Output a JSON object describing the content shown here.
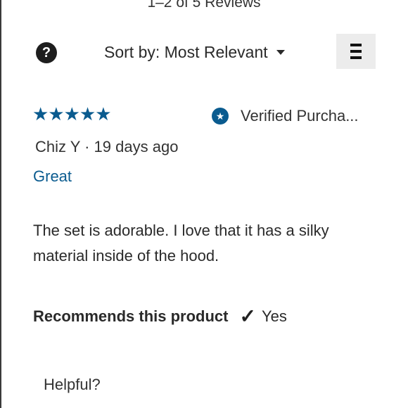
{
  "header": {
    "review_count": "1–2 of 5 Reviews"
  },
  "toolbar": {
    "help_glyph": "?",
    "sort_label": "Sort by: Most Relevant",
    "menu_icon": "hamburger-menu-icon"
  },
  "review": {
    "rating": 5,
    "rating_max": 5,
    "stars": "★★★★★",
    "verified_label": "Verified Purcha...",
    "verified_icon": "star-badge-icon",
    "author_line": "Chiz Y · 19 days ago",
    "title": "Great",
    "body": "The set is adorable. I love that it has a silky material inside of the hood.",
    "recommend_label": "Recommends this product",
    "recommend_value": "Yes",
    "helpful_label": "Helpful?"
  },
  "colors": {
    "accent": "#0a5b8f",
    "menu_bg": "#ececec"
  }
}
